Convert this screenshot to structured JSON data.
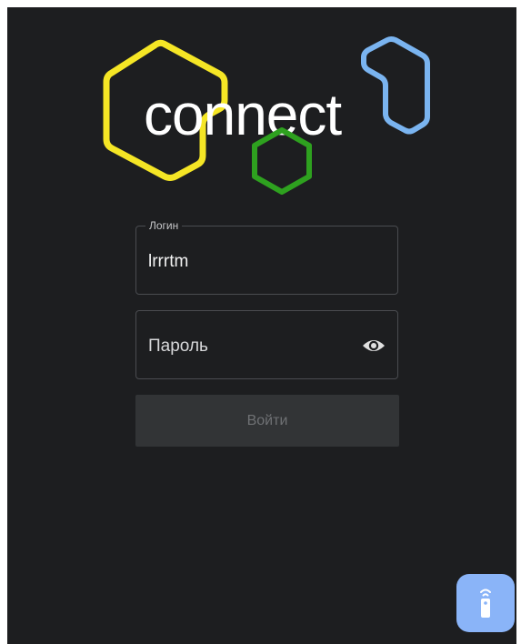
{
  "logo": {
    "text": "connect",
    "colors": {
      "yellow": "#f5e625",
      "green": "#2ea11f",
      "blue": "#7ab4f0"
    }
  },
  "login_field": {
    "legend": "Логин",
    "value": "lrrrtm"
  },
  "password_field": {
    "placeholder": "Пароль",
    "toggle_icon": "eye-icon"
  },
  "submit": {
    "label": "Войти",
    "enabled": false
  },
  "remote_button": {
    "icon": "remote-control-icon",
    "color": "#8ab4f8"
  }
}
